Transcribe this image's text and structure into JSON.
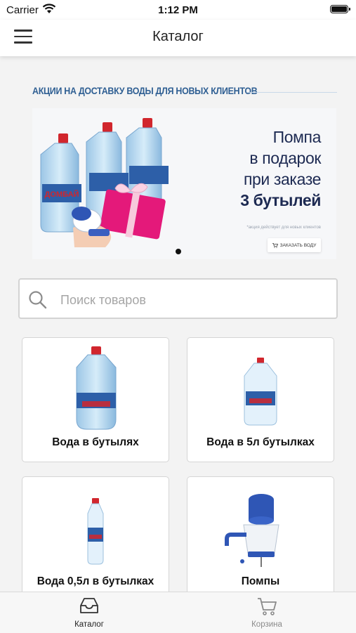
{
  "status_bar": {
    "carrier": "Carrier",
    "time": "1:12 PM"
  },
  "navbar": {
    "title": "Каталог"
  },
  "promo": {
    "heading": "АКЦИИ НА ДОСТАВКУ ВОДЫ ДЛЯ НОВЫХ КЛИЕНТОВ",
    "banner": {
      "line1": "Помпа",
      "line2": "в подарок",
      "line3": "при заказе",
      "line4": "3 бутылей",
      "note": "*акция действует для новых клиентов",
      "button_label": "ЗАКАЗАТЬ ВОДУ",
      "brand_label": "ДОМБАЙ"
    }
  },
  "search": {
    "placeholder": "Поиск товаров"
  },
  "categories": [
    {
      "label": "Вода в бутылях",
      "icon": "water-cooler-bottle-icon"
    },
    {
      "label": "Вода в 5л бутылках",
      "icon": "five-liter-bottle-icon"
    },
    {
      "label": "Вода 0,5л в бутылках",
      "icon": "small-bottle-icon"
    },
    {
      "label": "Помпы",
      "icon": "water-pump-icon"
    }
  ],
  "tabbar": {
    "tabs": [
      {
        "label": "Каталог",
        "icon": "catalog-inbox-icon",
        "active": true
      },
      {
        "label": "Корзина",
        "icon": "cart-icon",
        "active": false
      }
    ]
  },
  "colors": {
    "heading_blue": "#2f5f93",
    "banner_text": "#1d2a52",
    "tab_active": "#222222",
    "tab_inactive": "#8a8a8a"
  }
}
